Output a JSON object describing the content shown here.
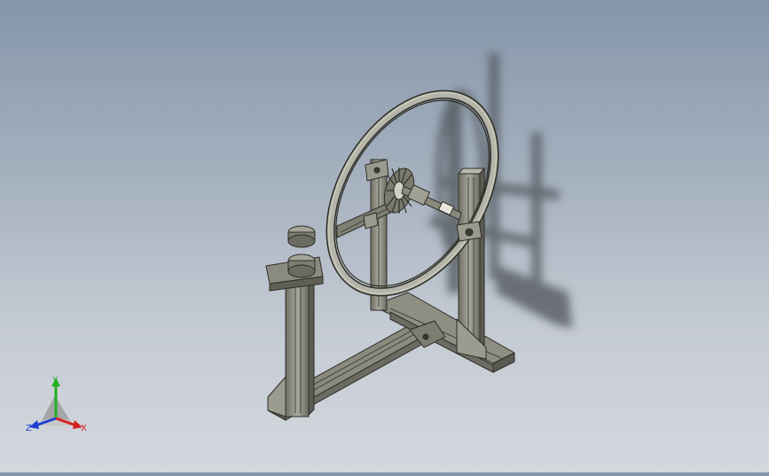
{
  "viewport": {
    "background_top": "#8596aa",
    "background_bottom": "#d4d8de",
    "model_color": "#8a8a7e",
    "model_edge_color": "#2e2e28",
    "shadow_color": "#4d5259"
  },
  "triad": {
    "x_label": "X",
    "y_label": "Y",
    "z_label": "Z",
    "x_color": "#d22020",
    "y_color": "#22b022",
    "z_color": "#2040d0"
  }
}
